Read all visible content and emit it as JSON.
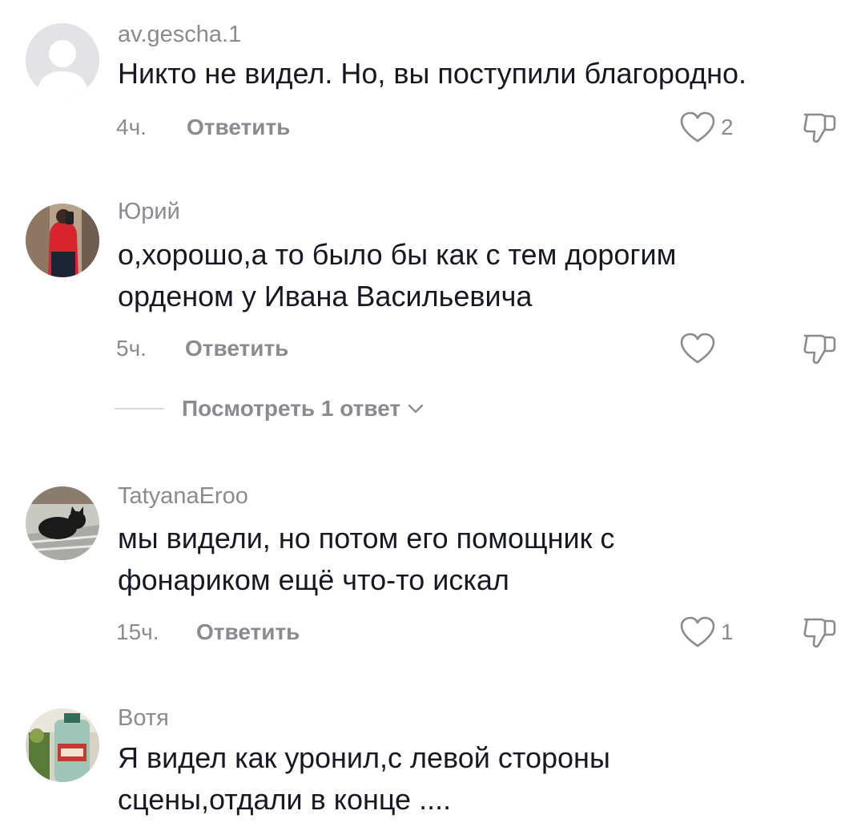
{
  "comments": [
    {
      "username": "av.gescha.1",
      "text": "Никто не видел. Но, вы поступили благородно.",
      "time": "4ч.",
      "reply_label": "Ответить",
      "likes": "2",
      "avatar": "default-avatar"
    },
    {
      "username": "Юрий",
      "text": "о,хорошо,а то было бы как с тем дорогим\nорденом у Ивана Васильевича",
      "time": "5ч.",
      "reply_label": "Ответить",
      "likes": "",
      "avatar": "photo-person-red-sweater",
      "view_replies_label": "Посмотреть 1 ответ"
    },
    {
      "username": "TatyanaEroo",
      "text": "мы видели, но потом его помощник с\nфонариком ещё что-то искал",
      "time": "15ч.",
      "reply_label": "Ответить",
      "likes": "1",
      "avatar": "photo-black-cat"
    },
    {
      "username": "Вотя",
      "text": "Я видел как уронил,с левой стороны\nсцены,отдали в конце ....",
      "avatar": "photo-bottles"
    }
  ],
  "icons": {
    "like": "heart-outline-icon",
    "dislike": "thumbs-down-outline-icon",
    "expand": "chevron-down-icon"
  },
  "colors": {
    "text_primary": "#161823",
    "text_secondary": "#8a8b91",
    "background": "#ffffff",
    "avatar_default": "#e3e3e6"
  }
}
